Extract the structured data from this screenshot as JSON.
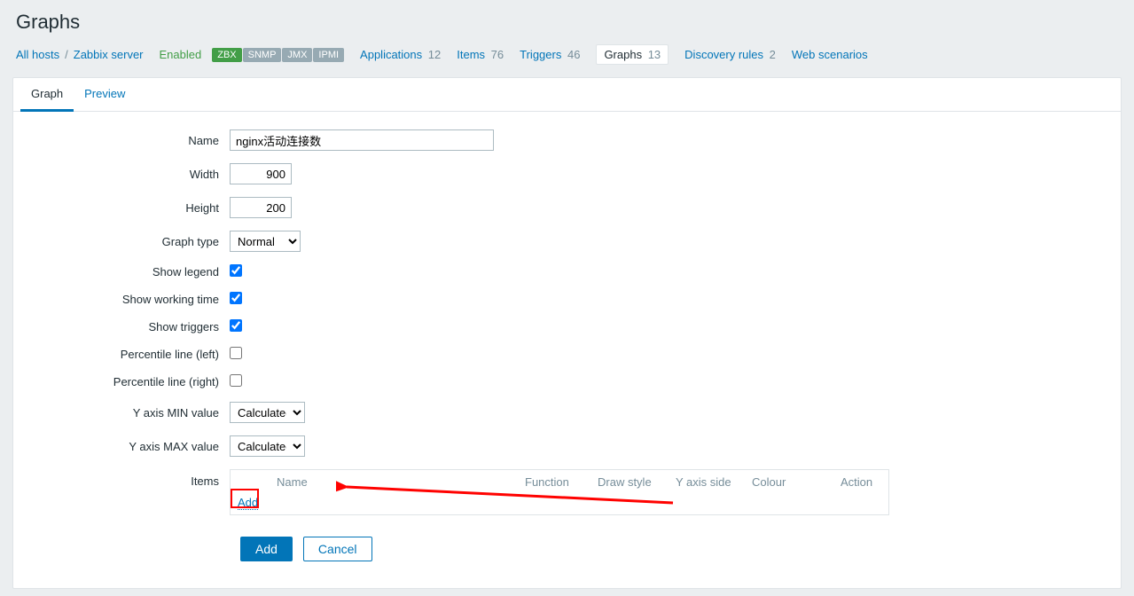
{
  "page": {
    "title": "Graphs"
  },
  "breadcrumb": {
    "all_hosts": "All hosts",
    "host": "Zabbix server",
    "enabled": "Enabled"
  },
  "badges": {
    "zbx": "ZBX",
    "snmp": "SNMP",
    "jmx": "JMX",
    "ipmi": "IPMI"
  },
  "nav": {
    "applications": {
      "label": "Applications",
      "count": "12"
    },
    "items": {
      "label": "Items",
      "count": "76"
    },
    "triggers": {
      "label": "Triggers",
      "count": "46"
    },
    "graphs": {
      "label": "Graphs",
      "count": "13"
    },
    "discovery": {
      "label": "Discovery rules",
      "count": "2"
    },
    "web": {
      "label": "Web scenarios",
      "count": ""
    }
  },
  "tabs": {
    "graph": "Graph",
    "preview": "Preview"
  },
  "form": {
    "name_label": "Name",
    "name_value": "nginx活动连接数",
    "width_label": "Width",
    "width_value": "900",
    "height_label": "Height",
    "height_value": "200",
    "graph_type_label": "Graph type",
    "graph_type_value": "Normal",
    "show_legend_label": "Show legend",
    "show_working_time_label": "Show working time",
    "show_triggers_label": "Show triggers",
    "percentile_left_label": "Percentile line (left)",
    "percentile_right_label": "Percentile line (right)",
    "yaxis_min_label": "Y axis MIN value",
    "yaxis_min_value": "Calculated",
    "yaxis_max_label": "Y axis MAX value",
    "yaxis_max_value": "Calculated",
    "items_label": "Items"
  },
  "items_table": {
    "headers": {
      "name": "Name",
      "function": "Function",
      "draw_style": "Draw style",
      "yaxis_side": "Y axis side",
      "colour": "Colour",
      "action": "Action"
    },
    "add_link": "Add"
  },
  "actions": {
    "add": "Add",
    "cancel": "Cancel"
  }
}
